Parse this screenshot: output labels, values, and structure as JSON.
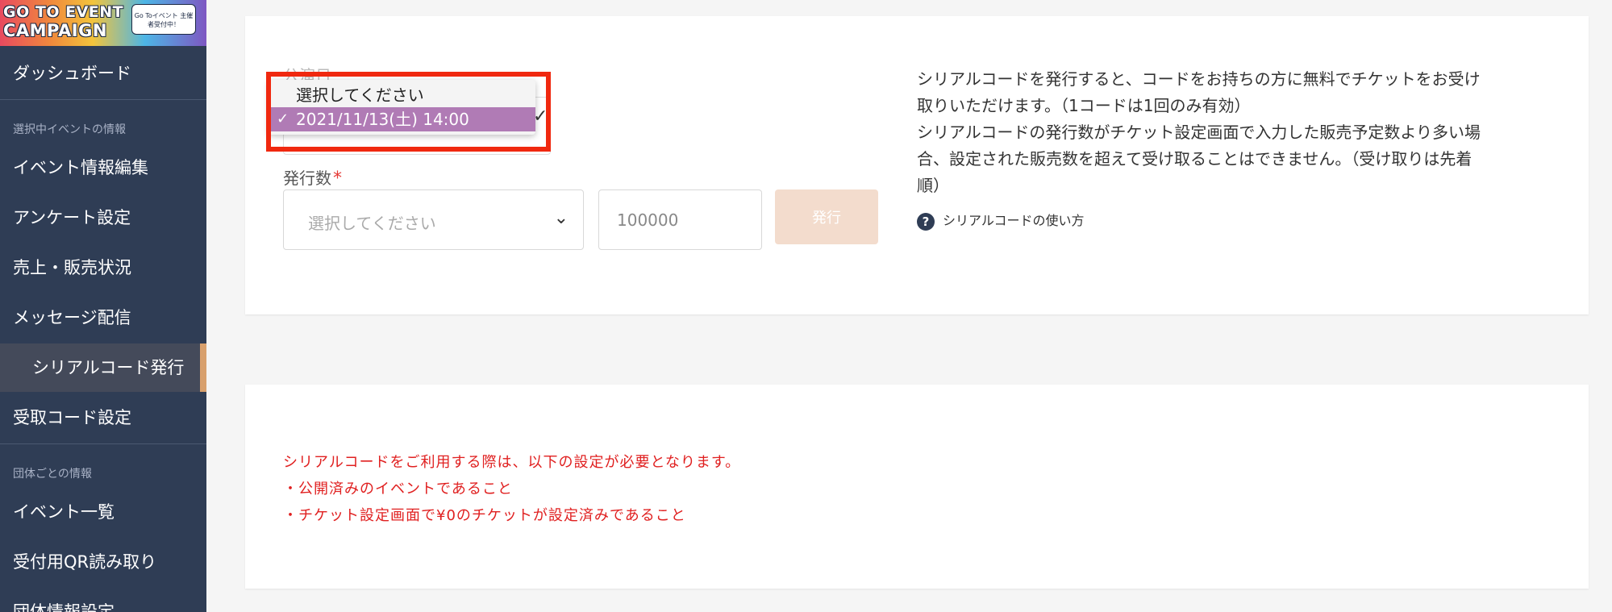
{
  "sidebar": {
    "banner": {
      "line1": "GO TO EVENT",
      "line2": "CAMPAIGN",
      "badge": "Go Toイベント 主催者受付中！"
    },
    "items": [
      {
        "label": "ダッシュボード"
      },
      {
        "label": "イベント情報編集"
      },
      {
        "label": "アンケート設定"
      },
      {
        "label": "売上・販売状況"
      },
      {
        "label": "メッセージ配信"
      },
      {
        "label": "シリアルコード発行"
      },
      {
        "label": "受取コード設定"
      },
      {
        "label": "イベント一覧"
      },
      {
        "label": "受付用QR読み取り"
      },
      {
        "label": "団体情報設定"
      }
    ],
    "section_event": "選択中イベントの情報",
    "section_org": "団体ごとの情報"
  },
  "form": {
    "date_label": "公演日",
    "date_select": {
      "options": [
        "選択してください",
        "2021/11/13(土) 14:00"
      ],
      "selected": "2021/11/13(土) 14:00"
    },
    "count_label": "発行数",
    "count_required": "*",
    "count_placeholder": "選択してください",
    "quantity_value": "100000",
    "issue_button": "発行"
  },
  "description": {
    "line1": "シリアルコードを発行すると、コードをお持ちの方に無料でチケットをお受け",
    "line2": "取りいただけます。（1コードは1回のみ有効）",
    "line3": "シリアルコードの発行数がチケット設定画面で入力した販売予定数より多い場",
    "line4": "合、設定された販売数を超えて受け取ることはできません。（受け取りは先着",
    "line5": "順）",
    "help_link": "シリアルコードの使い方"
  },
  "notes": {
    "line1": "シリアルコードをご利用する際は、以下の設定が必要となります。",
    "line2": "・公開済みのイベントであること",
    "line3": "・チケット設定画面で¥0のチケットが設定済みであること"
  },
  "colors": {
    "sidebar_bg": "#2f3d55",
    "active_accent": "#d8a06d",
    "selected_option": "#b07bb5",
    "highlight": "#f0280f",
    "notes_text": "#e02020",
    "issue_button": "#f3dccd"
  }
}
